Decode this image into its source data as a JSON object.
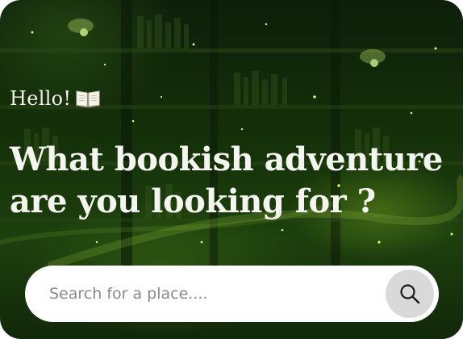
{
  "greeting": {
    "text": "Hello!",
    "icon": "open-book-icon"
  },
  "headline": {
    "line1": "What bookish adventure",
    "line2": "are you looking for ?"
  },
  "search": {
    "placeholder": "Search for a place....",
    "button_icon": "search-icon"
  },
  "colors": {
    "background_primary": "#143009",
    "accent_glow": "#9bd236",
    "text": "#f5f5ef",
    "search_button": "#d9d9d9"
  }
}
